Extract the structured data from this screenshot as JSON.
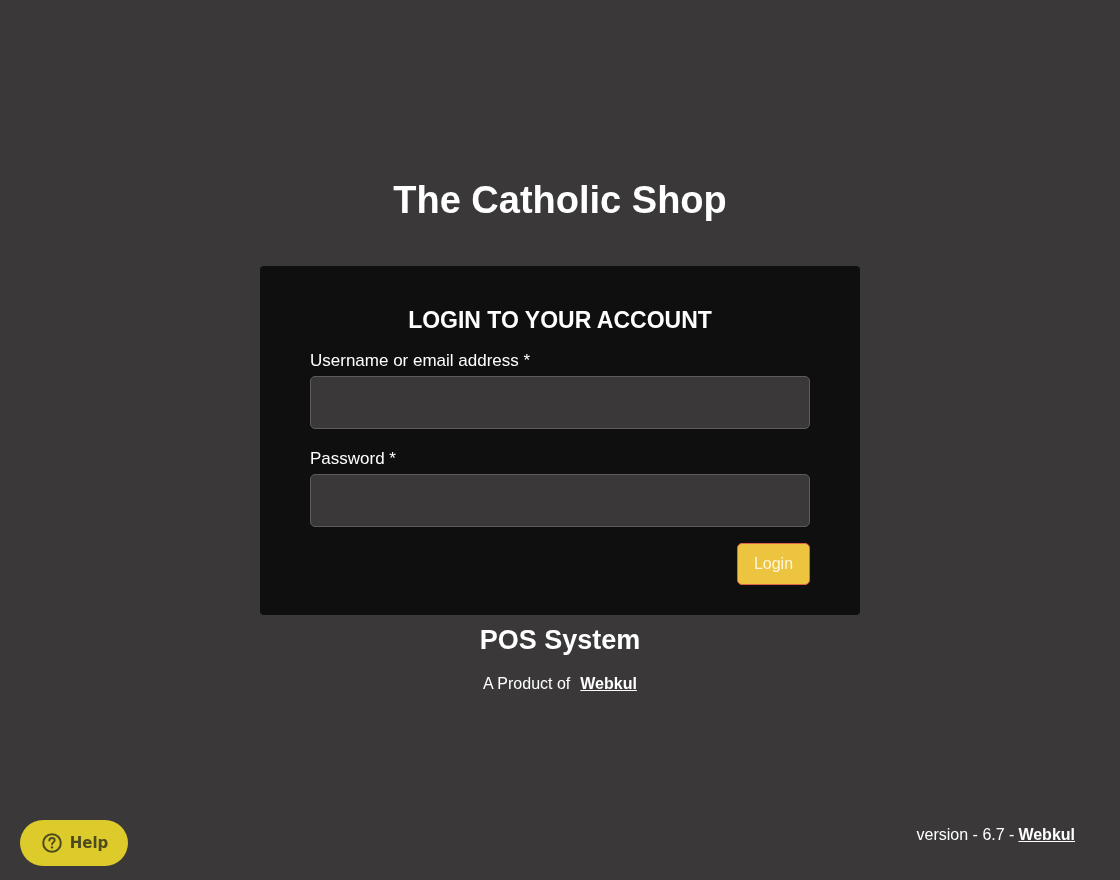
{
  "page": {
    "shop_name": "The Catholic Shop"
  },
  "login_form": {
    "heading": "LOGIN TO YOUR ACCOUNT",
    "fields": [
      {
        "label": "Username or email address *"
      },
      {
        "label": "Password *"
      }
    ],
    "submit_button": "Login"
  },
  "product": {
    "name": "POS System",
    "tagline": "A Product of",
    "link": "Webkul"
  },
  "footer": {
    "version": "version - 6.7 -",
    "link": "Webkul"
  },
  "help_button": {
    "label": "Help"
  }
}
